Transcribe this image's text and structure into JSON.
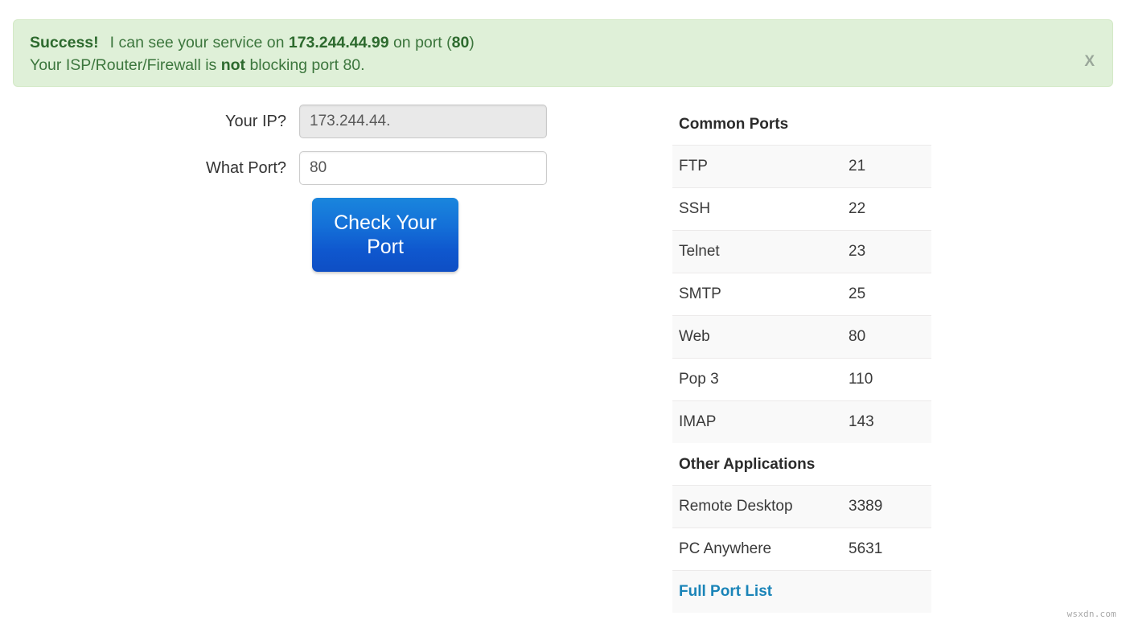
{
  "alert": {
    "status_label": "Success!",
    "line1_pre": "I can see your service on ",
    "line1_ip": "173.244.44.99",
    "line1_mid": " on port (",
    "line1_port": "80",
    "line1_post": ")",
    "line2_pre": "Your ISP/Router/Firewall is ",
    "line2_strong": "not",
    "line2_post": " blocking port 80.",
    "close_label": "X",
    "bg_color": "#dff0d8",
    "text_color": "#3c763d"
  },
  "form": {
    "ip_label": "Your IP?",
    "ip_value": "173.244.44.",
    "ip_placeholder": "Your IP",
    "port_label": "What Port?",
    "port_value": "80",
    "port_placeholder": "Port",
    "submit_label": "Check Your Port",
    "submit_color": "#1470d8"
  },
  "ports": {
    "common_heading": "Common Ports",
    "common_rows": [
      {
        "name": "FTP",
        "port": "21"
      },
      {
        "name": "SSH",
        "port": "22"
      },
      {
        "name": "Telnet",
        "port": "23"
      },
      {
        "name": "SMTP",
        "port": "25"
      },
      {
        "name": "Web",
        "port": "80"
      },
      {
        "name": "Pop 3",
        "port": "110"
      },
      {
        "name": "IMAP",
        "port": "143"
      }
    ],
    "other_heading": "Other Applications",
    "other_rows": [
      {
        "name": "Remote Desktop",
        "port": "3389"
      },
      {
        "name": "PC Anywhere",
        "port": "5631"
      }
    ],
    "full_list_label": "Full Port List",
    "link_color": "#1a84b8"
  },
  "watermark": "wsxdn.com"
}
